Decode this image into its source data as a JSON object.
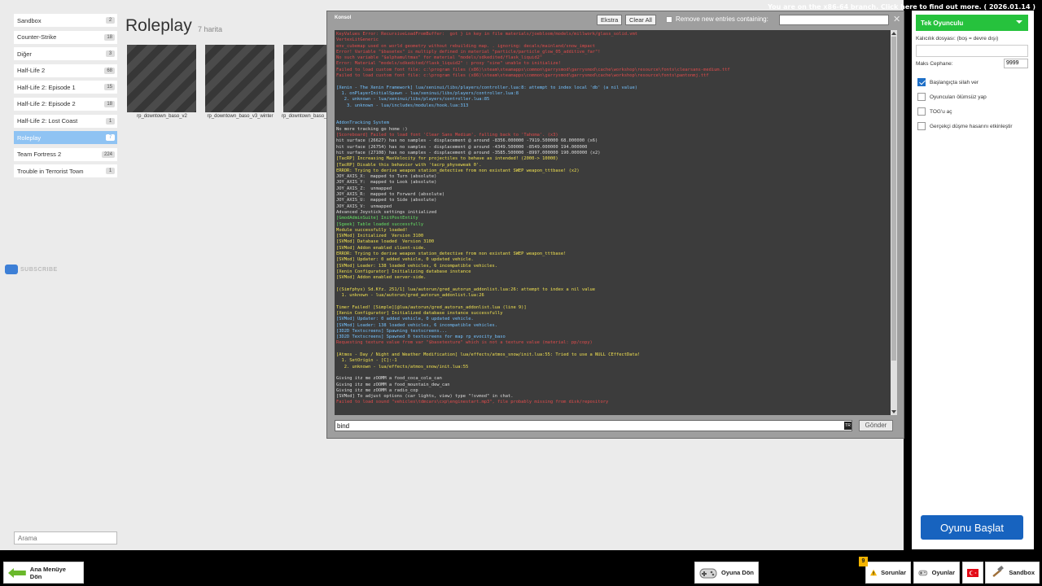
{
  "top_notice": "You are on the x86-64 branch. Click here to find out more. ( 2026.01.14 )",
  "sidebar": {
    "categories": [
      {
        "label": "Sandbox",
        "count": "2"
      },
      {
        "label": "Counter-Strike",
        "count": "18"
      },
      {
        "label": "Diğer",
        "count": "3"
      },
      {
        "label": "Half-Life 2",
        "count": "68"
      },
      {
        "label": "Half-Life 2: Episode 1",
        "count": "15"
      },
      {
        "label": "Half-Life 2: Episode 2",
        "count": "18"
      },
      {
        "label": "Half-Life 2: Lost Coast",
        "count": "1"
      },
      {
        "label": "Roleplay",
        "count": "7"
      },
      {
        "label": "Team Fortress 2",
        "count": "224"
      },
      {
        "label": "Trouble in Terrorist Town",
        "count": "1"
      }
    ],
    "search_placeholder": "Arama"
  },
  "main": {
    "title": "Roleplay",
    "subtitle": "7 harita",
    "maps": [
      {
        "name": "rp_downtown_baso_v2"
      },
      {
        "name": "rp_downtown_baso_v3_winter"
      },
      {
        "name": "rp_downtown_baso_v2"
      }
    ]
  },
  "subscribe_text": "SUBSCRIBE",
  "console": {
    "title": "Konsol",
    "buttons": {
      "extra": "Ekstra",
      "clear": "Clear All"
    },
    "remove_label": "Remove new entries containing:",
    "command_value": "bind ",
    "lang": "TR",
    "send_label": "Gönder",
    "lines": [
      {
        "t": "KeyValues Error: RecursiveLoadFromBuffer:  got } in key in file materials/joebloom/models/millwork/glass_solid.vmt",
        "c": "#e04b4b"
      },
      {
        "t": "VertexLitGeneric",
        "c": "#e04b4b"
      },
      {
        "t": "env_cubemap used on world geometry without rebuilding map. . ignoring: decals/mainland/snow_impact",
        "c": "#e04b4b"
      },
      {
        "t": "Error! Variable \"$basetex\" is multiply defined in material \"particle/particle_glow_05_additive_far\"!",
        "c": "#e04b4b"
      },
      {
        "t": "No such variable \"$alphamultmax\" for material \"models/sdkedited/flask_liquid2\"",
        "c": "#e04b4b"
      },
      {
        "t": "Error: Material \"models/sdkedited/flask_liquid2\" : proxy \"sine\" unable to initialize!",
        "c": "#e04b4b"
      },
      {
        "t": "Failed to load custom font file: c:\\program files (x86)\\steam\\steamapps\\common\\garrysmod\\garrysmod\\cache\\workshop\\resource\\fonts\\clearsans-medium.ttf",
        "c": "#e04b4b"
      },
      {
        "t": "Failed to load custom font file: c:\\program files (x86)\\steam\\steamapps\\common\\garrysmod\\garrysmod\\cache\\workshop\\resource\\fonts\\pantonmj.ttf",
        "c": "#e04b4b"
      },
      {
        "t": " ",
        "c": "#ddd"
      },
      {
        "t": "[Xenin - The Xenin Framework] lua/xeninui/libs/players/controller.lua:8: attempt to index local 'db' (a nil value)",
        "c": "#74c2ff"
      },
      {
        "t": "  1. onPlayerInitialSpawn - lua/xeninui/libs/players/controller.lua:8",
        "c": "#74c2ff"
      },
      {
        "t": "   2. unknown - lua/xeninui/libs/players/controller.lua:85",
        "c": "#74c2ff"
      },
      {
        "t": "    3. unknown - lua/includes/modules/hook.lua:313",
        "c": "#74c2ff"
      },
      {
        "t": " ",
        "c": "#ddd"
      },
      {
        "t": " ",
        "c": "#ddd"
      },
      {
        "t": "AddonTracking System",
        "c": "#74c2ff"
      },
      {
        "t": "No more tracking go home :)",
        "c": "#dddddd"
      },
      {
        "t": "[Scoreboard] Failed to load font 'Clear Sans Medium', falling back to 'Tahoma'. (x3)",
        "c": "#e04b4b"
      },
      {
        "t": "hit surface (26627) has no samples - displacement @ around -8356.000000 -7919.500000 68.000000 (x6)",
        "c": "#dddddd"
      },
      {
        "t": "hit surface (26754) has no samples - displacement @ around -4349.500000 -8549.000000 194.000000",
        "c": "#dddddd"
      },
      {
        "t": "hit surface (27108) has no samples - displacement @ around -3585.500000 -8997.000000 190.000000 (x2)",
        "c": "#dddddd"
      },
      {
        "t": "[TacRP] Increasing MaxVelocity for projectiles to behave as intended! (2000-> 10000)",
        "c": "#f0e050"
      },
      {
        "t": "[TacRP] Disable this behavior with 'tacrp_physeweak 0'.",
        "c": "#f0e050"
      },
      {
        "t": "ERROR: Trying to derive weapon station_detective from non existant SWEP weapon_tttbase! (x2)",
        "c": "#f0e050"
      },
      {
        "t": "JOY_AXIS_X:  mapped to Turn (absolute)",
        "c": "#dddddd"
      },
      {
        "t": "JOY_AXIS_Y:  mapped to Look (absolute)",
        "c": "#dddddd"
      },
      {
        "t": "JOY_AXIS_Z:  unmapped",
        "c": "#dddddd"
      },
      {
        "t": "JOY_AXIS_R:  mapped to Forward (absolute)",
        "c": "#dddddd"
      },
      {
        "t": "JOY_AXIS_U:  mapped to Side (absolute)",
        "c": "#dddddd"
      },
      {
        "t": "JOY_AXIS_V:  unmapped",
        "c": "#dddddd"
      },
      {
        "t": "Advanced Joystick settings initialized",
        "c": "#dddddd"
      },
      {
        "t": "[GmodAdminSuite] InitPostEntity",
        "c": "#65e065"
      },
      {
        "t": "[Sgeek] Table loaded successfully",
        "c": "#65e065"
      },
      {
        "t": "Module successfully loaded!",
        "c": "#f0e050"
      },
      {
        "t": "[SVMod] Initialized  Version 3100",
        "c": "#f0e050"
      },
      {
        "t": "[SVMod] Database loaded  Version 3100",
        "c": "#f0e050"
      },
      {
        "t": "[SVMod] Addon enabled client-side.",
        "c": "#f0e050"
      },
      {
        "t": "ERROR: Trying to derive weapon station_detective from non existant SWEP weapon_tttbase!",
        "c": "#f0e050"
      },
      {
        "t": "[SVMod] Updater: 0 added vehicle, 0 updated vehicle.",
        "c": "#f0e050"
      },
      {
        "t": "[SVMod] Loader: 138 loaded vehicles, 6 incompatible vehicles.",
        "c": "#f0e050"
      },
      {
        "t": "[Xenin Configurator] Initializing database instance",
        "c": "#f0e050"
      },
      {
        "t": "[SVMod] Addon enabled server-side.",
        "c": "#f0e050"
      },
      {
        "t": " ",
        "c": "#ddd"
      },
      {
        "t": "[(Simfphys) Sd.Kfz. 251/1] lua/autorun/gred_autorun_addonlist.lua:26: attempt to index a nil value",
        "c": "#f0e050"
      },
      {
        "t": "  1. unknown - lua/autorun/gred_autorun_addonlist.lua:26",
        "c": "#f0e050"
      },
      {
        "t": " ",
        "c": "#ddd"
      },
      {
        "t": "Timer Failed! [Simple][@lua/autorun/gred_autorun_addonlist.lua (line 9)]",
        "c": "#f0e050"
      },
      {
        "t": "[Xenin Configurator] Initialized database instance successfully",
        "c": "#f0e050"
      },
      {
        "t": "[SVMod] Updater: 0 added vehicle, 0 updated vehicle.",
        "c": "#74c2ff"
      },
      {
        "t": "[SVMod] Loader: 138 loaded vehicles, 6 incompatible vehicles.",
        "c": "#74c2ff"
      },
      {
        "t": "[3D2D Textscreens] Spawning textscreens...",
        "c": "#74c2ff"
      },
      {
        "t": "[3D2D Textscreens] Spawned 0 textscreens for map rp_evocity_baso",
        "c": "#74c2ff"
      },
      {
        "t": "Requesting texture value from var \"$basetexture\" which is not a texture value (material: pp/copy)",
        "c": "#e04b4b"
      },
      {
        "t": " ",
        "c": "#ddd"
      },
      {
        "t": "[Atmos - Day / Night and Weather Modification] lua/effects/atmos_snow/init.lua:55: Tried to use a NULL CEffectData!",
        "c": "#f0e050"
      },
      {
        "t": "  1. SetOrigin - [C]:-1",
        "c": "#f0e050"
      },
      {
        "t": "   2. unknown - lua/effects/atmos_snow/init.lua:55",
        "c": "#f0e050"
      },
      {
        "t": " ",
        "c": "#ddd"
      },
      {
        "t": "Giving itz me zOOMM a food_coca_cola_can",
        "c": "#dddddd"
      },
      {
        "t": "Giving itz me zOOMM a food_mountain_dew_can",
        "c": "#dddddd"
      },
      {
        "t": "Giving itz me zOOMM a radio_cop",
        "c": "#dddddd"
      },
      {
        "t": "[SVMod] To adjust options (car lights, view) type \"!svmod\" in chat.",
        "c": "#dddddd"
      },
      {
        "t": "Failed to load sound \"vehicles\\tdmcars\\cxp\\enginestart.mp3\", file probably missing from disk/repository",
        "c": "#e04b4b"
      }
    ]
  },
  "right_panel": {
    "mode": "Tek Oyunculu",
    "persistence_label": "Kalıcılık dosyası: (boş = devre dışı)",
    "ammo_label": "Maks Cephane:",
    "ammo_value": "9999",
    "options": [
      {
        "label": "Başlangıçta silah ver",
        "checked": true
      },
      {
        "label": "Oyuncuları ölümsüz yap",
        "checked": false
      },
      {
        "label": "TOG'u aç",
        "checked": false
      },
      {
        "label": "Gerçekçi düşme hasarını etkinleştir",
        "checked": false
      }
    ],
    "start_label": "Oyunu Başlat"
  },
  "bottom_bar": {
    "back_label": "Ana Menüye Dön",
    "resume_label": "Oyuna Dön",
    "problems_label": "Sorunlar",
    "problems_count": "9",
    "games_label": "Oyunlar",
    "gamemode_label": "Sandbox"
  },
  "colors": {
    "accent_green": "#26c23d",
    "accent_blue": "#1763bf",
    "active_category": "#8fc3f3"
  }
}
